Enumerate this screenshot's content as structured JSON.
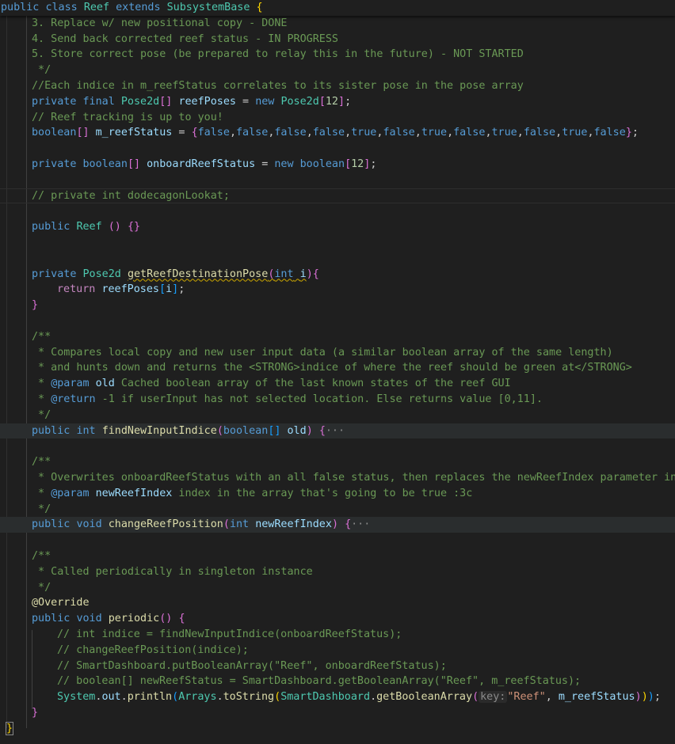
{
  "lines": [
    {
      "y": 0,
      "indent": 1,
      "sticky": true,
      "tokens": [
        [
          "kw",
          "public"
        ],
        [
          "pl",
          " "
        ],
        [
          "kw",
          "class"
        ],
        [
          "pl",
          " "
        ],
        [
          "typ",
          "Reef"
        ],
        [
          "pl",
          " "
        ],
        [
          "kw",
          "extends"
        ],
        [
          "pl",
          " "
        ],
        [
          "typ",
          "SubsystemBase"
        ],
        [
          "pl",
          " "
        ],
        [
          "br1",
          "{"
        ]
      ]
    },
    {
      "y": 1,
      "indent": 40,
      "tokens": [
        [
          "cm",
          "3. Replace w/ new positional copy - DONE"
        ]
      ]
    },
    {
      "y": 2,
      "indent": 40,
      "tokens": [
        [
          "cm",
          "4. Send back corrected reef status - IN PROGRESS"
        ]
      ]
    },
    {
      "y": 3,
      "indent": 40,
      "tokens": [
        [
          "cm",
          "5. Store correct pose (be prepared to relay this in the future) - NOT STARTED"
        ]
      ]
    },
    {
      "y": 4,
      "indent": 40,
      "tokens": [
        [
          "cm",
          " */"
        ]
      ]
    },
    {
      "y": 5,
      "indent": 40,
      "tokens": [
        [
          "cm",
          "//Each indice in m_reefStatus correlates to its sister pose in the pose array"
        ]
      ]
    },
    {
      "y": 6,
      "indent": 40,
      "tokens": [
        [
          "kw",
          "private"
        ],
        [
          "pl",
          " "
        ],
        [
          "kw",
          "final"
        ],
        [
          "pl",
          " "
        ],
        [
          "typ",
          "Pose2d"
        ],
        [
          "br2",
          "[]"
        ],
        [
          "pl",
          " "
        ],
        [
          "var",
          "reefPoses"
        ],
        [
          "pl",
          " = "
        ],
        [
          "kw",
          "new"
        ],
        [
          "pl",
          " "
        ],
        [
          "typ",
          "Pose2d"
        ],
        [
          "br2",
          "["
        ],
        [
          "num",
          "12"
        ],
        [
          "br2",
          "]"
        ],
        [
          "pl",
          ";"
        ]
      ]
    },
    {
      "y": 7,
      "indent": 40,
      "tokens": [
        [
          "cm",
          "// Reef tracking is up to you!"
        ]
      ]
    },
    {
      "y": 8,
      "indent": 40,
      "tokens": [
        [
          "kw",
          "boolean"
        ],
        [
          "br2",
          "[]"
        ],
        [
          "pl",
          " "
        ],
        [
          "var",
          "m_reefStatus"
        ],
        [
          "pl",
          " = "
        ],
        [
          "br2",
          "{"
        ],
        [
          "kw",
          "false"
        ],
        [
          "pl",
          ","
        ],
        [
          "kw",
          "false"
        ],
        [
          "pl",
          ","
        ],
        [
          "kw",
          "false"
        ],
        [
          "pl",
          ","
        ],
        [
          "kw",
          "false"
        ],
        [
          "pl",
          ","
        ],
        [
          "kw",
          "true"
        ],
        [
          "pl",
          ","
        ],
        [
          "kw",
          "false"
        ],
        [
          "pl",
          ","
        ],
        [
          "kw",
          "true"
        ],
        [
          "pl",
          ","
        ],
        [
          "kw",
          "false"
        ],
        [
          "pl",
          ","
        ],
        [
          "kw",
          "true"
        ],
        [
          "pl",
          ","
        ],
        [
          "kw",
          "false"
        ],
        [
          "pl",
          ","
        ],
        [
          "kw",
          "true"
        ],
        [
          "pl",
          ","
        ],
        [
          "kw",
          "false"
        ],
        [
          "br2",
          "}"
        ],
        [
          "pl",
          ";"
        ]
      ]
    },
    {
      "y": 9,
      "indent": 40,
      "tokens": []
    },
    {
      "y": 10,
      "indent": 40,
      "tokens": [
        [
          "kw",
          "private"
        ],
        [
          "pl",
          " "
        ],
        [
          "kw",
          "boolean"
        ],
        [
          "br2",
          "[]"
        ],
        [
          "pl",
          " "
        ],
        [
          "var",
          "onboardReefStatus"
        ],
        [
          "pl",
          " = "
        ],
        [
          "kw",
          "new"
        ],
        [
          "pl",
          " "
        ],
        [
          "kw",
          "boolean"
        ],
        [
          "br2",
          "["
        ],
        [
          "num",
          "12"
        ],
        [
          "br2",
          "]"
        ],
        [
          "pl",
          ";"
        ]
      ]
    },
    {
      "y": 11,
      "indent": 40,
      "tokens": []
    },
    {
      "y": 12,
      "indent": 40,
      "cursorline": true,
      "tokens": [
        [
          "cm",
          "// private int dodecagonLookat;"
        ]
      ]
    },
    {
      "y": 13,
      "indent": 40,
      "tokens": []
    },
    {
      "y": 14,
      "indent": 40,
      "tokens": [
        [
          "kw",
          "public"
        ],
        [
          "pl",
          " "
        ],
        [
          "typ",
          "Reef"
        ],
        [
          "pl",
          " "
        ],
        [
          "br2",
          "()"
        ],
        [
          "pl",
          " "
        ],
        [
          "br2",
          "{}"
        ]
      ]
    },
    {
      "y": 15,
      "indent": 40,
      "tokens": []
    },
    {
      "y": 16,
      "indent": 40,
      "tokens": []
    },
    {
      "y": 17,
      "indent": 40,
      "tokens": [
        [
          "kw",
          "private"
        ],
        [
          "pl",
          " "
        ],
        [
          "typ",
          "Pose2d"
        ],
        [
          "pl",
          " "
        ],
        [
          "fn squig",
          "getReefDestinationPose"
        ],
        [
          "br2 squig",
          "("
        ],
        [
          "kw squig",
          "int"
        ],
        [
          "pl squig",
          " "
        ],
        [
          "var squig",
          "i"
        ],
        [
          "br2",
          "){"
        ]
      ]
    },
    {
      "y": 18,
      "indent": 72,
      "tokens": [
        [
          "ctl",
          "return"
        ],
        [
          "pl",
          " "
        ],
        [
          "var",
          "reefPoses"
        ],
        [
          "br3",
          "["
        ],
        [
          "var",
          "i"
        ],
        [
          "br3",
          "]"
        ],
        [
          "pl",
          ";"
        ]
      ]
    },
    {
      "y": 19,
      "indent": 40,
      "tokens": [
        [
          "br2",
          "}"
        ]
      ]
    },
    {
      "y": 20,
      "indent": 40,
      "tokens": []
    },
    {
      "y": 21,
      "indent": 40,
      "tokens": [
        [
          "cm",
          "/**"
        ]
      ]
    },
    {
      "y": 22,
      "indent": 40,
      "tokens": [
        [
          "cm",
          " * Compares local copy and new user input data (a similar boolean array of the same length)"
        ]
      ]
    },
    {
      "y": 23,
      "indent": 40,
      "tokens": [
        [
          "cm",
          " * and hunts down and returns the <STRONG>indice of where the reef should be green at</STRONG>"
        ]
      ]
    },
    {
      "y": 24,
      "indent": 40,
      "tokens": [
        [
          "cm",
          " * "
        ],
        [
          "doc",
          "@param"
        ],
        [
          "pl",
          " "
        ],
        [
          "var",
          "old"
        ],
        [
          "cm",
          " Cached boolean array of the last known states of the reef GUI"
        ]
      ]
    },
    {
      "y": 25,
      "indent": 40,
      "tokens": [
        [
          "cm",
          " * "
        ],
        [
          "doc",
          "@return"
        ],
        [
          "cm",
          " -1 if userInput has not selected location. Else returns value [0,11]."
        ]
      ]
    },
    {
      "y": 26,
      "indent": 40,
      "tokens": [
        [
          "cm",
          " */"
        ]
      ]
    },
    {
      "y": 27,
      "indent": 40,
      "highlight": true,
      "tokens": [
        [
          "kw",
          "public"
        ],
        [
          "pl",
          " "
        ],
        [
          "kw",
          "int"
        ],
        [
          "pl",
          " "
        ],
        [
          "fn",
          "findNewInputIndice"
        ],
        [
          "br2",
          "("
        ],
        [
          "kw",
          "boolean"
        ],
        [
          "br3",
          "[]"
        ],
        [
          "pl",
          " "
        ],
        [
          "var",
          "old"
        ],
        [
          "br2",
          ")"
        ],
        [
          "pl",
          " "
        ],
        [
          "br2",
          "{"
        ],
        [
          "fold",
          "···"
        ]
      ]
    },
    {
      "y": 28,
      "indent": 40,
      "tokens": []
    },
    {
      "y": 29,
      "indent": 40,
      "tokens": [
        [
          "cm",
          "/**"
        ]
      ]
    },
    {
      "y": 30,
      "indent": 40,
      "tokens": [
        [
          "cm",
          " * Overwrites onboardReefStatus with an all false status, then replaces the newReefIndex parameter inc"
        ]
      ]
    },
    {
      "y": 31,
      "indent": 40,
      "tokens": [
        [
          "cm",
          " * "
        ],
        [
          "doc",
          "@param"
        ],
        [
          "pl",
          " "
        ],
        [
          "var",
          "newReefIndex"
        ],
        [
          "cm",
          " index in the array that's going to be true :3c"
        ]
      ]
    },
    {
      "y": 32,
      "indent": 40,
      "tokens": [
        [
          "cm",
          " */"
        ]
      ]
    },
    {
      "y": 33,
      "indent": 40,
      "highlight": true,
      "tokens": [
        [
          "kw",
          "public"
        ],
        [
          "pl",
          " "
        ],
        [
          "kw",
          "void"
        ],
        [
          "pl",
          " "
        ],
        [
          "fn",
          "changeReefPosition"
        ],
        [
          "br2",
          "("
        ],
        [
          "kw",
          "int"
        ],
        [
          "pl",
          " "
        ],
        [
          "var",
          "newReefIndex"
        ],
        [
          "br2",
          ")"
        ],
        [
          "pl",
          " "
        ],
        [
          "br2",
          "{"
        ],
        [
          "fold",
          "···"
        ]
      ]
    },
    {
      "y": 34,
      "indent": 40,
      "tokens": []
    },
    {
      "y": 35,
      "indent": 40,
      "tokens": [
        [
          "cm",
          "/**"
        ]
      ]
    },
    {
      "y": 36,
      "indent": 40,
      "tokens": [
        [
          "cm",
          " * Called periodically in singleton instance"
        ]
      ]
    },
    {
      "y": 37,
      "indent": 40,
      "tokens": [
        [
          "cm",
          " */"
        ]
      ]
    },
    {
      "y": 38,
      "indent": 40,
      "tokens": [
        [
          "fn",
          "@Override"
        ]
      ]
    },
    {
      "y": 39,
      "indent": 40,
      "tokens": [
        [
          "kw",
          "public"
        ],
        [
          "pl",
          " "
        ],
        [
          "kw",
          "void"
        ],
        [
          "pl",
          " "
        ],
        [
          "fn",
          "periodic"
        ],
        [
          "br2",
          "()"
        ],
        [
          "pl",
          " "
        ],
        [
          "br2",
          "{"
        ]
      ]
    },
    {
      "y": 40,
      "indent": 72,
      "tokens": [
        [
          "cm",
          "// int indice = findNewInputIndice(onboardReefStatus);"
        ]
      ]
    },
    {
      "y": 41,
      "indent": 72,
      "tokens": [
        [
          "cm",
          "// changeReefPosition(indice);"
        ]
      ]
    },
    {
      "y": 42,
      "indent": 72,
      "tokens": [
        [
          "cm",
          "// SmartDashboard.putBooleanArray(\"Reef\", onboardReefStatus);"
        ]
      ]
    },
    {
      "y": 43,
      "indent": 72,
      "tokens": [
        [
          "cm",
          "// boolean[] newReefStatus = SmartDashboard.getBooleanArray(\"Reef\", m_reefStatus);"
        ]
      ]
    },
    {
      "y": 44,
      "indent": 72,
      "tokens": [
        [
          "typ",
          "System"
        ],
        [
          "pl",
          "."
        ],
        [
          "var",
          "out"
        ],
        [
          "pl",
          "."
        ],
        [
          "fn",
          "println"
        ],
        [
          "br3",
          "("
        ],
        [
          "typ",
          "Arrays"
        ],
        [
          "pl",
          "."
        ],
        [
          "fn",
          "toString"
        ],
        [
          "br1",
          "("
        ],
        [
          "typ",
          "SmartDashboard"
        ],
        [
          "pl",
          "."
        ],
        [
          "fn",
          "getBooleanArray"
        ],
        [
          "br2",
          "("
        ],
        [
          "hint",
          "key:"
        ],
        [
          "str",
          "\"Reef\""
        ],
        [
          "pl",
          ", "
        ],
        [
          "var",
          "m_reefStatus"
        ],
        [
          "br2",
          ")"
        ],
        [
          "br1",
          ")"
        ],
        [
          "br3",
          ")"
        ],
        [
          "pl",
          ";"
        ]
      ]
    },
    {
      "y": 45,
      "indent": 40,
      "tokens": [
        [
          "br2",
          "}"
        ]
      ]
    },
    {
      "y": 46,
      "indent": 8,
      "tokens": [
        [
          "br1 bracket-box",
          "}"
        ]
      ]
    }
  ]
}
